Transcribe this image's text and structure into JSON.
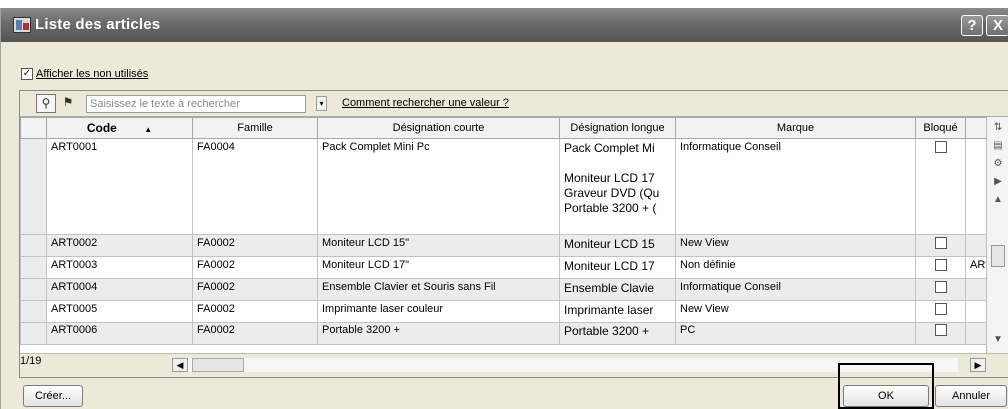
{
  "window": {
    "title": "Liste des articles"
  },
  "titlebar_buttons": {
    "help": "?",
    "close": "X"
  },
  "show_unused": {
    "label": "Afficher les non utilisés",
    "checked": true
  },
  "search": {
    "placeholder": "Saisissez le texte à rechercher",
    "help_link": "Comment rechercher une valeur ?"
  },
  "table": {
    "columns": [
      "Code",
      "Famille",
      "Désignation courte",
      "Désignation longue",
      "Marque",
      "Bloqué"
    ],
    "rows": [
      {
        "code": "ART0001",
        "famille": "FA0004",
        "courte": "Pack Complet Mini Pc",
        "longue": [
          "Pack Complet Mi",
          "",
          "Moniteur LCD 17",
          "Graveur DVD (Qu",
          "Portable 3200 + ("
        ],
        "marque": "Informatique Conseil",
        "extra": ""
      },
      {
        "code": "ART0002",
        "famille": "FA0002",
        "courte": "Moniteur LCD 15\"",
        "longue": [
          "Moniteur LCD 15"
        ],
        "marque": "New View",
        "extra": ""
      },
      {
        "code": "ART0003",
        "famille": "FA0002",
        "courte": "Moniteur LCD 17\"",
        "longue": [
          "Moniteur LCD 17"
        ],
        "marque": "Non définie",
        "extra": "ARт"
      },
      {
        "code": "ART0004",
        "famille": "FA0002",
        "courte": "Ensemble Clavier et Souris sans Fil",
        "longue": [
          "Ensemble Clavie"
        ],
        "marque": "Informatique Conseil",
        "extra": ""
      },
      {
        "code": "ART0005",
        "famille": "FA0002",
        "courte": "Imprimante laser couleur",
        "longue": [
          "Imprimante laser"
        ],
        "marque": "New View",
        "extra": ""
      },
      {
        "code": "ART0006",
        "famille": "FA0002",
        "courte": "Portable 3200 +",
        "longue": [
          "Portable 3200 +"
        ],
        "marque": "PC",
        "extra": ""
      }
    ]
  },
  "pager": {
    "count": "1/19"
  },
  "buttons": {
    "create": "Créer...",
    "ok": "OK",
    "cancel": "Annuler"
  }
}
